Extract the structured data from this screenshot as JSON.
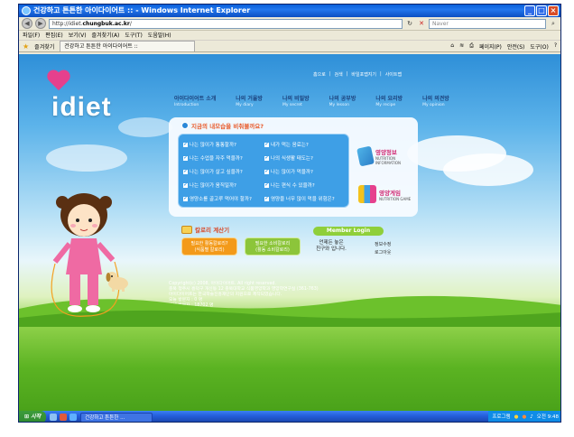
{
  "window": {
    "title": "건강하고 튼튼한 아이다이어트 :: - Windows Internet Explorer",
    "url_prefix": "http://idiet.",
    "url_domain": "chungbuk.ac.kr",
    "url_suffix": "/",
    "search_placeholder": "Naver",
    "menu": [
      "파일(F)",
      "편집(E)",
      "보기(V)",
      "즐겨찾기(A)",
      "도구(T)",
      "도움말(H)"
    ],
    "favorites_label": "즐겨찾기",
    "tab_label": "건강하고 튼튼한 아이다이어트 ::",
    "tools": [
      "페이지(P)",
      "안전(S)",
      "도구(O)"
    ]
  },
  "site": {
    "logo": "idiet",
    "top_links": [
      "홈으로",
      "검색",
      "바일포맵지기",
      "사이트맵"
    ],
    "nav": [
      {
        "ko": "아이다이어트 소개",
        "en": "Introduction"
      },
      {
        "ko": "나의 거울방",
        "en": "My diary"
      },
      {
        "ko": "나의 비밀방",
        "en": "My secret"
      },
      {
        "ko": "나의 공부방",
        "en": "My lesson"
      },
      {
        "ko": "나의 요리방",
        "en": "My recipe"
      },
      {
        "ko": "나의 의견방",
        "en": "My opinion"
      }
    ],
    "panel_title": "지금의 내모습을 비춰볼까요?",
    "questions_left": [
      "나는 많이가 통통할까?",
      "나는 수업을 자주 먹을까?",
      "나는 많이가 살고 싶을까?",
      "나는 많이가 움직일까?",
      "영양소를 골고루 먹어야 할까?"
    ],
    "questions_right": [
      "내가 먹는 음료는?",
      "나의 식생활 태도는?",
      "나는 많이가 먹을까?",
      "나는 편식 수 있을까?",
      "영양을 너무 많이 먹을 위험은?"
    ],
    "side_cards": [
      {
        "title": "영양정보",
        "sub": "NUTRITION INFORMATION"
      },
      {
        "title": "영양게임",
        "sub": "NUTRITION GAME"
      }
    ],
    "calc_title": "칼로리 계산기",
    "calc_buttons": [
      {
        "line1": "필요한 활동칼로리?",
        "line2": "(식품별 칼로리)"
      },
      {
        "line1": "필요한 소비칼로리",
        "line2": "(활동 소비칼로리)"
      }
    ],
    "login_title": "Member Login",
    "login_msg_1": "언제든 놓은",
    "login_msg_2": "친구와 입니다.",
    "login_links": [
      "정보수정",
      "로그아웃"
    ],
    "footer": [
      "Copyright(c) 2008, 아이다이어트. All right reserved.",
      "충북 청주시 흥덕구 개신동 12 충북대학교 식품영양학과 영양학연구실 (361-763)",
      "아이다이어트는 한국학술진흥재단의 지원으로 제작되었습니다.",
      "오늘 방문자 : 0 명",
      "전체 방문자 : 18702 명"
    ]
  },
  "taskbar": {
    "start": "시작",
    "task": "건강하고 튼튼한 ...",
    "tray_label": "프로그램",
    "clock": "오전 9:48"
  },
  "colors": {
    "sky": "#2e8fd8",
    "grass": "#5bb322",
    "accent_pink": "#e6408d",
    "question_box": "#3e9fe6",
    "calc_orange": "#f39a1a",
    "calc_green": "#8cc53a"
  }
}
